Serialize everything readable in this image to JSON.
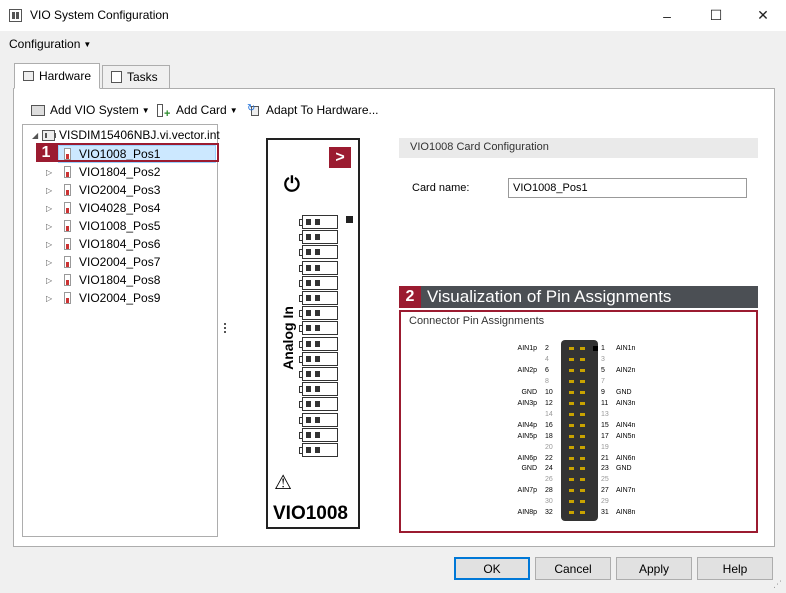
{
  "window": {
    "title": "VIO System Configuration",
    "minimize": "–",
    "maximize": "☐",
    "close": "✕"
  },
  "menu": {
    "configuration": "Configuration"
  },
  "tabs": [
    {
      "label": "Hardware",
      "active": true
    },
    {
      "label": "Tasks",
      "active": false
    }
  ],
  "toolbar": {
    "add_vio_system": "Add VIO System",
    "add_card": "Add Card",
    "adapt": "Adapt To Hardware..."
  },
  "tree": {
    "root": "VISDIM15406NBJ.vi.vector.int",
    "items": [
      {
        "label": "VIO1008_Pos1",
        "selected": true,
        "expander": false
      },
      {
        "label": "VIO1804_Pos2",
        "expander": true
      },
      {
        "label": "VIO2004_Pos3",
        "expander": true
      },
      {
        "label": "VIO4028_Pos4",
        "expander": true
      },
      {
        "label": "VIO1008_Pos5",
        "expander": true
      },
      {
        "label": "VIO1804_Pos6",
        "expander": true
      },
      {
        "label": "VIO2004_Pos7",
        "expander": true
      },
      {
        "label": "VIO1804_Pos8",
        "expander": true
      },
      {
        "label": "VIO2004_Pos9",
        "expander": true
      }
    ]
  },
  "callouts": {
    "one": "1",
    "two": "2"
  },
  "device": {
    "arrow": ">",
    "power": "⏻",
    "side_label": "Analog In",
    "warning": "⚠",
    "model": "VIO1008",
    "port_count": 16
  },
  "config": {
    "header": "VIO1008 Card Configuration",
    "card_name_label": "Card name:",
    "card_name_value": "VIO1008_Pos1"
  },
  "visualization": {
    "title": "Visualization of Pin Assignments",
    "box_title": "Connector Pin Assignments",
    "rows": [
      {
        "ln": "AIN1p",
        "lp": "2",
        "rp": "1",
        "rn": "AIN1n",
        "gray": false
      },
      {
        "ln": "",
        "lp": "4",
        "rp": "3",
        "rn": "",
        "gray": true
      },
      {
        "ln": "AIN2p",
        "lp": "6",
        "rp": "5",
        "rn": "AIN2n",
        "gray": false
      },
      {
        "ln": "",
        "lp": "8",
        "rp": "7",
        "rn": "",
        "gray": true
      },
      {
        "ln": "GND",
        "lp": "10",
        "rp": "9",
        "rn": "GND",
        "gray": false
      },
      {
        "ln": "AIN3p",
        "lp": "12",
        "rp": "11",
        "rn": "AIN3n",
        "gray": false
      },
      {
        "ln": "",
        "lp": "14",
        "rp": "13",
        "rn": "",
        "gray": true
      },
      {
        "ln": "AIN4p",
        "lp": "16",
        "rp": "15",
        "rn": "AIN4n",
        "gray": false
      },
      {
        "ln": "AIN5p",
        "lp": "18",
        "rp": "17",
        "rn": "AIN5n",
        "gray": false
      },
      {
        "ln": "",
        "lp": "20",
        "rp": "19",
        "rn": "",
        "gray": true
      },
      {
        "ln": "AIN6p",
        "lp": "22",
        "rp": "21",
        "rn": "AIN6n",
        "gray": false
      },
      {
        "ln": "GND",
        "lp": "24",
        "rp": "23",
        "rn": "GND",
        "gray": false
      },
      {
        "ln": "",
        "lp": "26",
        "rp": "25",
        "rn": "",
        "gray": true
      },
      {
        "ln": "AIN7p",
        "lp": "28",
        "rp": "27",
        "rn": "AIN7n",
        "gray": false
      },
      {
        "ln": "",
        "lp": "30",
        "rp": "29",
        "rn": "",
        "gray": true
      },
      {
        "ln": "AIN8p",
        "lp": "32",
        "rp": "31",
        "rn": "AIN8n",
        "gray": false
      }
    ]
  },
  "buttons": {
    "ok": "OK",
    "cancel": "Cancel",
    "apply": "Apply",
    "help": "Help"
  },
  "colors": {
    "accent": "#9b1b30",
    "vis_bar": "#4b4f54",
    "selection": "#cce8ff"
  }
}
